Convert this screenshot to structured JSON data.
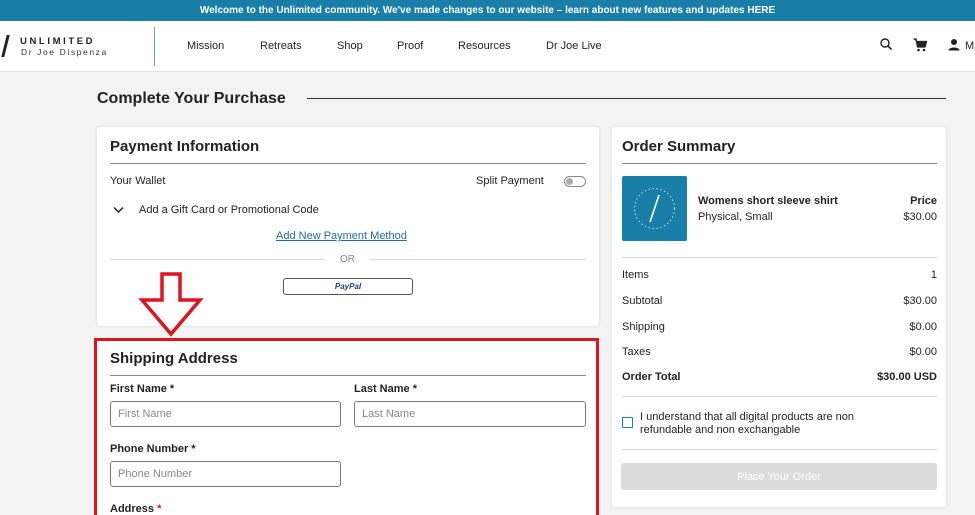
{
  "banner": {
    "text": "Welcome to the Unlimited community. We've made changes to our website – learn about new features and updates HERE"
  },
  "brand": {
    "name": "UNLIMITED",
    "sub": "Dr Joe Dispenza"
  },
  "nav": {
    "items": [
      "Mission",
      "Retreats",
      "Shop",
      "Proof",
      "Resources",
      "Dr Joe Live"
    ],
    "account_label": "M",
    "icons": [
      "search-icon",
      "cart-icon",
      "user-icon"
    ]
  },
  "page": {
    "title": "Complete Your Purchase"
  },
  "payment": {
    "title": "Payment Information",
    "wallet_label": "Your Wallet",
    "split_label": "Split Payment",
    "split_enabled": false,
    "gift_label": "Add a Gift Card or Promotional Code",
    "add_method_link": "Add New Payment Method",
    "or_label": "OR",
    "paypal_label": "PayPal"
  },
  "shipping": {
    "title": "Shipping Address",
    "first_name": {
      "label": "First Name *",
      "placeholder": "First Name",
      "value": ""
    },
    "last_name": {
      "label": "Last Name *",
      "placeholder": "Last Name",
      "value": ""
    },
    "phone": {
      "label": "Phone Number *",
      "placeholder": "Phone Number",
      "value": ""
    },
    "address": {
      "label": "Address",
      "required_mark": "*"
    }
  },
  "order": {
    "title": "Order Summary",
    "product": {
      "name": "Womens short sleeve shirt",
      "variant": "Physical, Small",
      "price_label": "Price",
      "price": "$30.00"
    },
    "rows": [
      {
        "label": "Items",
        "value": "1"
      },
      {
        "label": "Subtotal",
        "value": "$30.00"
      },
      {
        "label": "Shipping",
        "value": "$0.00"
      },
      {
        "label": "Taxes",
        "value": "$0.00"
      }
    ],
    "total": {
      "label": "Order Total",
      "value": "$30.00 USD"
    },
    "consent_text_1": "I understand that all digital products are non",
    "consent_text_2": "refundable and non exchangable",
    "consent_checked": false,
    "place_order_label": "Place Your Order"
  },
  "annotation": {
    "color": "#e0141e"
  },
  "colors": {
    "accent": "#1a7fa8",
    "link": "#1a6fa0"
  }
}
